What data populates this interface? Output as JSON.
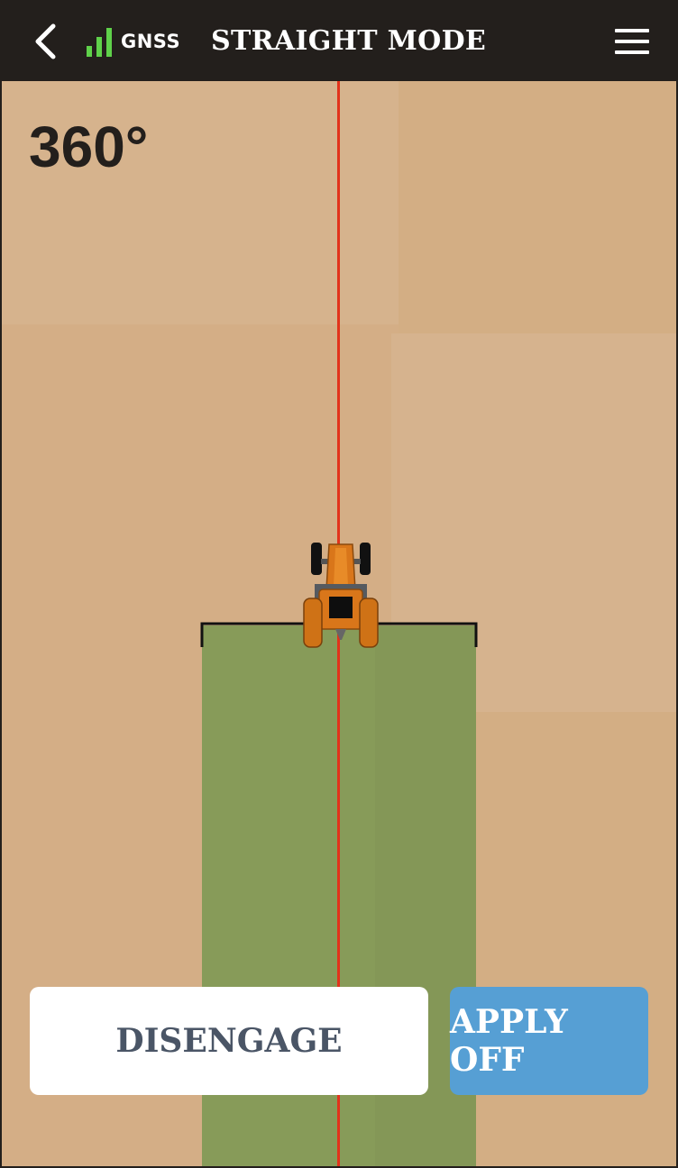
{
  "header": {
    "back_icon": "chevron-left-icon",
    "gnss_icon": "signal-bars-icon",
    "gnss_label": "GNSS",
    "title": "STRAIGHT MODE",
    "menu_icon": "hamburger-menu-icon"
  },
  "map": {
    "heading": "360°",
    "vehicle_icon": "tractor-icon"
  },
  "actions": {
    "disengage_label": "DISENGAGE",
    "apply_label": "APPLY OFF"
  },
  "colors": {
    "topbar": "#231f1c",
    "signal": "#5fd14a",
    "guidance_line": "#e2331b",
    "coverage": "#879b59",
    "field": "#d4ae86",
    "apply_button": "#569fd4",
    "disengage_text": "#4a5566"
  }
}
